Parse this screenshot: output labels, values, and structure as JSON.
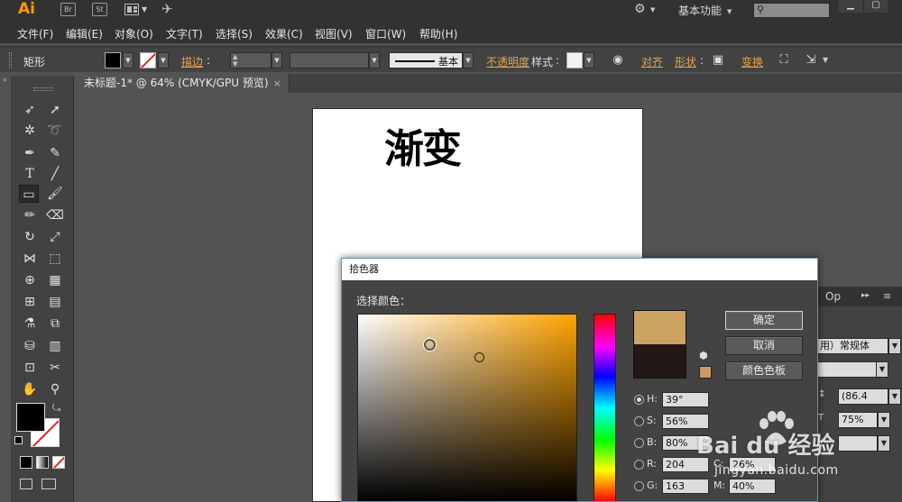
{
  "app": {
    "logo": "Ai",
    "bridge_button": "Br",
    "stock_button": "St",
    "workspace": "基本功能",
    "colors": {
      "logo": "#ff9a00",
      "chrome": "#323232",
      "panel": "#424242",
      "link": "#e8a34c"
    }
  },
  "menu": {
    "items": [
      "文件(F)",
      "编辑(E)",
      "对象(O)",
      "文字(T)",
      "选择(S)",
      "效果(C)",
      "视图(V)",
      "窗口(W)",
      "帮助(H)"
    ]
  },
  "control_bar": {
    "selection_label": "矩形",
    "stroke_label": "描边",
    "stroke_style": "基本",
    "opacity_label": "不透明度",
    "style_label": "样式",
    "align_label": "对齐",
    "shape_label": "形状",
    "transform_label": "变换",
    "fill_color": "#000000"
  },
  "document": {
    "tab_title": "未标题-1* @ 64% (CMYK/GPU 预览)",
    "close_glyph": "×",
    "artboard_text": "渐变"
  },
  "toolbar": {
    "fill_color": "#000000",
    "stroke_color": "none"
  },
  "right_panel": {
    "tab_label": "Op",
    "font_style": "用）常规体",
    "field_1": "(86.4",
    "field_2": "75%"
  },
  "color_picker": {
    "title": "拾色器",
    "select_color_label": "选择颜色：",
    "ok_button": "确定",
    "cancel_button": "取消",
    "swatches_button": "颜色色板",
    "new_color": "#cca363",
    "old_color": "#231815",
    "websafe_color": "#cc9966",
    "fields": [
      {
        "label": "H:",
        "value": "39°",
        "selected": true
      },
      {
        "label": "S:",
        "value": "56%",
        "selected": false
      },
      {
        "label": "B:",
        "value": "80%",
        "selected": false
      },
      {
        "label": "R:",
        "value": "204",
        "selected": false
      },
      {
        "label": "G:",
        "value": "163",
        "selected": false
      }
    ],
    "cmyk_fields": [
      {
        "label": "C:",
        "value": "26%"
      },
      {
        "label": "M:",
        "value": "40%"
      }
    ]
  },
  "watermark": {
    "text": "Bai du 经验",
    "url": "jingyan.baidu.com"
  }
}
